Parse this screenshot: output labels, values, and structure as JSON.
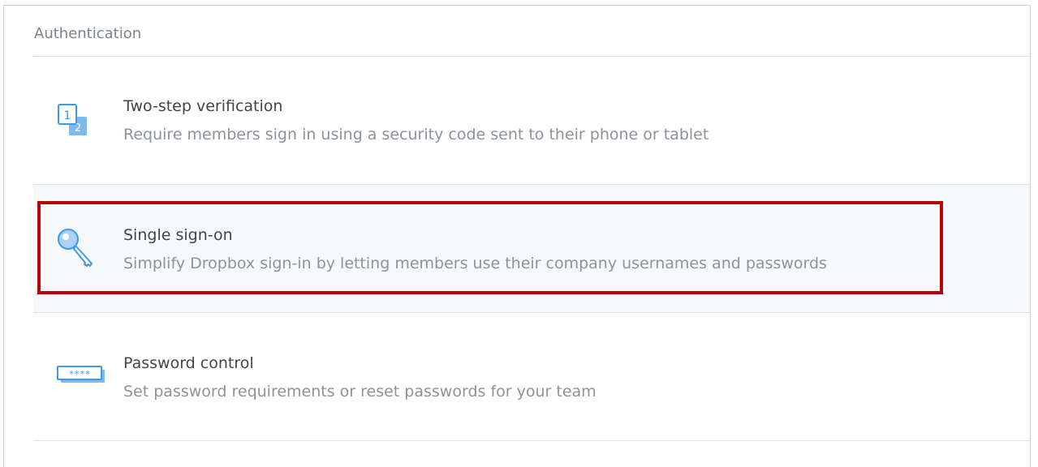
{
  "section": {
    "title": "Authentication"
  },
  "rows": [
    {
      "icon": "two-step-icon",
      "title": "Two-step verification",
      "description": "Require members sign in using a security code sent to their phone or tablet"
    },
    {
      "icon": "key-icon",
      "title": "Single sign-on",
      "description": "Simplify Dropbox sign-in by letting members use their company usernames and passwords"
    },
    {
      "icon": "password-field-icon",
      "title": "Password control",
      "description": "Set password requirements or reset passwords for your team"
    }
  ],
  "colors": {
    "accent": "#3d9ae8",
    "highlight_border": "#b8000d",
    "highlight_background": "#f6f9fc"
  }
}
